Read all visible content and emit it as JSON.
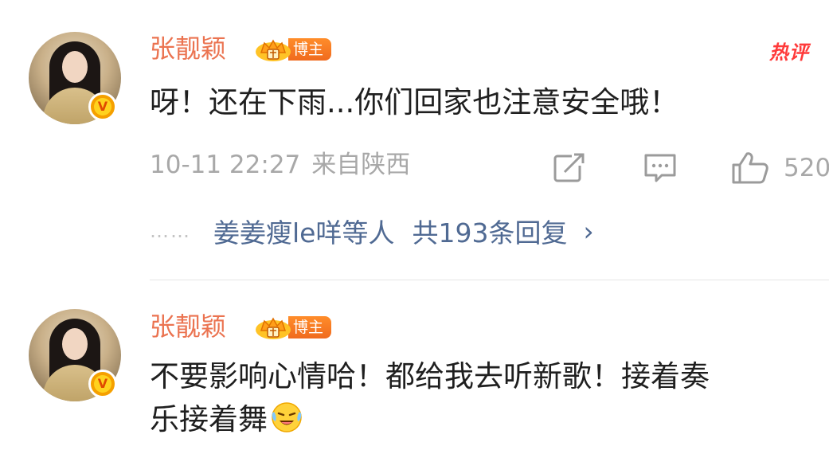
{
  "comments": [
    {
      "username": "张靓颖",
      "badge_label": "博主",
      "hot_tag": "热评",
      "text_lines": [
        "呀！还在下雨...你们回家也注意安全哦！"
      ],
      "time": "10-11 22:27",
      "location": "来自陕西",
      "like_count": "520",
      "replies": {
        "dots": "……",
        "names": "姜姜瘦le咩等人",
        "total": "共193条回复",
        "chevron": "›"
      },
      "icons": {
        "avatar": "avatar-photo",
        "verified": "verified-v-icon",
        "crown": "crown-icon",
        "share": "share-icon",
        "comment": "comment-icon",
        "like": "thumb-up-icon"
      }
    },
    {
      "username": "张靓颖",
      "badge_label": "博主",
      "text_lines": [
        "不要影响心情哈！都给我去听新歌！接着奏",
        "乐接着舞"
      ],
      "emoji": "laugh-cry-emoji",
      "icons": {
        "avatar": "avatar-photo",
        "verified": "verified-v-icon",
        "crown": "crown-icon"
      }
    }
  ],
  "verified_mark": "V",
  "colors": {
    "username": "#eb7350",
    "reply_link": "#506a93",
    "meta": "#a8a8a8",
    "hot": "#ff3a3a",
    "badge": "#f06a1e"
  }
}
